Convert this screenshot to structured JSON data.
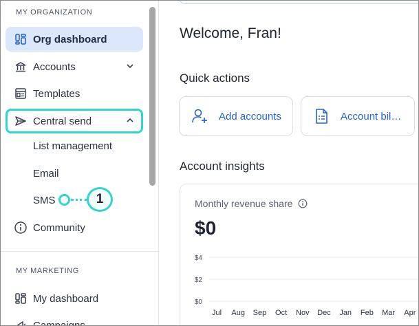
{
  "sidebar": {
    "org_section": "MY ORGANIZATION",
    "items": [
      {
        "label": "Org dashboard",
        "icon": "dashboard-icon"
      },
      {
        "label": "Accounts",
        "icon": "building-icon"
      },
      {
        "label": "Templates",
        "icon": "templates-icon"
      },
      {
        "label": "Central send",
        "icon": "send-icon"
      }
    ],
    "sub_items": [
      {
        "label": "List management"
      },
      {
        "label": "Email"
      },
      {
        "label": "SMS"
      }
    ],
    "community": {
      "label": "Community",
      "icon": "info-circle-icon"
    },
    "marketing_section": "MY MARKETING",
    "marketing_items": [
      {
        "label": "My dashboard",
        "icon": "dashboard-icon"
      },
      {
        "label": "Campaigns",
        "icon": "campaigns-icon"
      }
    ]
  },
  "callout": {
    "number": "1"
  },
  "main": {
    "welcome": "Welcome, Fran!",
    "quick_actions_title": "Quick actions",
    "actions": [
      {
        "label": "Add accounts",
        "icon": "add-user-icon"
      },
      {
        "label": "Account bil…",
        "icon": "billing-document-icon"
      }
    ],
    "insights_title": "Account insights",
    "insight_card": {
      "title": "Monthly revenue share",
      "value": "$0"
    }
  },
  "colors": {
    "accent": "#2563c9",
    "highlight": "#2fd6cb",
    "active_bg": "#dbe8fb"
  },
  "chart_data": {
    "type": "line",
    "categories": [
      "Jul",
      "Aug",
      "Sep",
      "Oct",
      "Nov",
      "Dec",
      "Jan",
      "Feb",
      "Mar",
      "Apr"
    ],
    "y_ticks": [
      "$4",
      "$2",
      "$0"
    ],
    "ylim": [
      0,
      4
    ],
    "values": [
      0,
      0,
      0,
      0,
      0,
      0,
      0,
      0,
      0,
      0
    ]
  }
}
